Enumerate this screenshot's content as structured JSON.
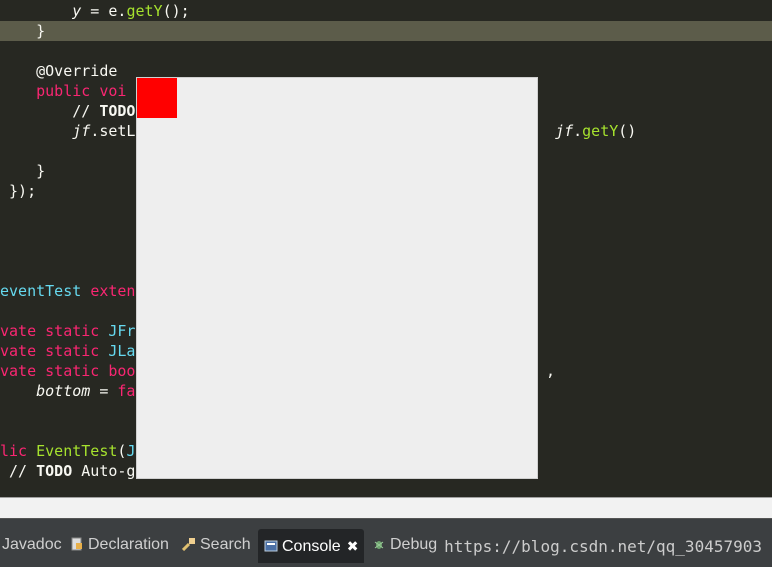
{
  "code_lines": [
    {
      "indent": "        ",
      "parts": [
        [
          "y",
          "it"
        ],
        [
          " = ",
          ""
        ],
        [
          "e",
          ""
        ],
        [
          ".",
          ""
        ],
        [
          "getY",
          "fn"
        ],
        [
          "();",
          ""
        ]
      ]
    },
    {
      "indent": "    ",
      "parts": [
        [
          "}",
          ""
        ]
      ]
    },
    {
      "indent": "",
      "parts": []
    },
    {
      "indent": "    ",
      "parts": [
        [
          "@Override",
          ""
        ]
      ]
    },
    {
      "indent": "    ",
      "parts": [
        [
          "public voi",
          "kw"
        ]
      ]
    },
    {
      "indent": "        ",
      "parts": [
        [
          "// ",
          "cm"
        ],
        [
          "TODO",
          "bold"
        ]
      ]
    },
    {
      "indent": "        ",
      "parts": [
        [
          "jf",
          "it"
        ],
        [
          ".setL",
          ""
        ]
      ]
    },
    {
      "indent": "",
      "parts": []
    },
    {
      "indent": "    ",
      "parts": [
        [
          "}",
          ""
        ]
      ]
    },
    {
      "indent": " ",
      "parts": [
        [
          "});",
          ""
        ]
      ]
    },
    {
      "indent": "",
      "parts": []
    },
    {
      "indent": "",
      "parts": []
    },
    {
      "indent": "",
      "parts": []
    },
    {
      "indent": "",
      "parts": []
    },
    {
      "indent": "",
      "parts": [
        [
          "eventTest ",
          "ty"
        ],
        [
          "extends",
          "kw"
        ]
      ]
    },
    {
      "indent": "",
      "parts": []
    },
    {
      "indent": "",
      "parts": [
        [
          "vate static ",
          "kw"
        ],
        [
          "JFra",
          "ty"
        ]
      ]
    },
    {
      "indent": "",
      "parts": [
        [
          "vate static ",
          "kw"
        ],
        [
          "JLab",
          "ty"
        ]
      ]
    },
    {
      "indent": "",
      "parts": [
        [
          "vate static ",
          "kw"
        ],
        [
          "bool",
          "kw"
        ]
      ]
    },
    {
      "indent": "    ",
      "parts": [
        [
          "bottom",
          "it"
        ],
        [
          " = ",
          ""
        ],
        [
          "fa",
          "kw"
        ]
      ]
    },
    {
      "indent": "",
      "parts": []
    },
    {
      "indent": "",
      "parts": []
    },
    {
      "indent": "",
      "parts": [
        [
          "lic ",
          "kw"
        ],
        [
          "EventTest",
          "fn"
        ],
        [
          "(",
          ""
        ],
        [
          "JF",
          "ty"
        ]
      ]
    },
    {
      "indent": " ",
      "parts": [
        [
          "// ",
          "cm"
        ],
        [
          "TODO",
          "bold"
        ],
        [
          " Auto-generated constructor stub",
          ""
        ]
      ]
    }
  ],
  "right_fragments": {
    "line_7": [
      [
        "jf",
        "it"
      ],
      [
        ".",
        ""
      ],
      [
        "getY",
        "fn"
      ],
      [
        "()",
        ""
      ]
    ],
    "line_19": [
      [
        ",",
        ""
      ]
    ]
  },
  "tabs": {
    "javadoc": "Javadoc",
    "declaration": "Declaration",
    "search": "Search",
    "console": "Console",
    "debug": "Debug"
  },
  "watermark": "https://blog.csdn.net/qq_30457903",
  "colors": {
    "editor_bg": "#272822",
    "keyword": "#f92672",
    "type": "#66d9ef",
    "function": "#a6e22e",
    "red_square": "#ff0000",
    "window_bg": "#eeeeee"
  }
}
